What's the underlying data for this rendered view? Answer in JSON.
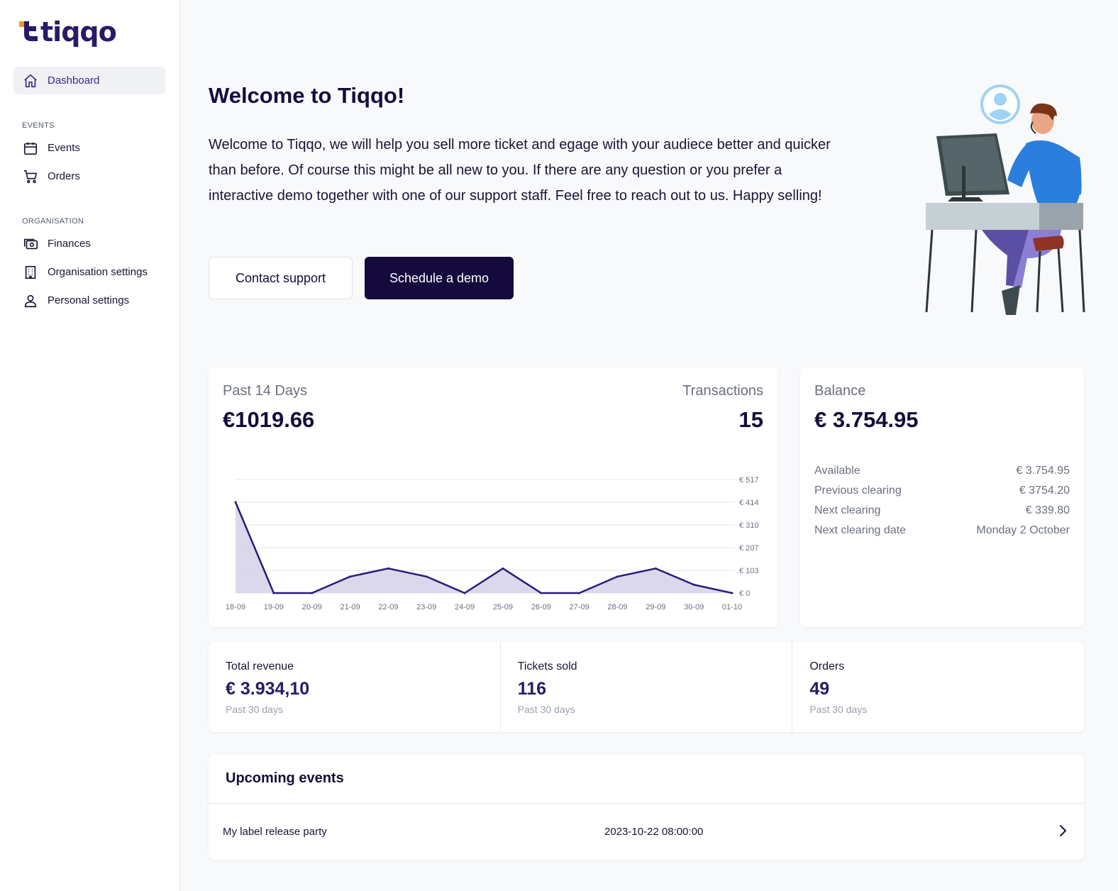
{
  "brand": {
    "name": "tiqqo",
    "accent": "#2a1a66",
    "orange": "#f7931e"
  },
  "sidebar": {
    "dashboard": "Dashboard",
    "events_section": "EVENTS",
    "events": "Events",
    "orders": "Orders",
    "organisation_section": "ORGANISATION",
    "finances": "Finances",
    "organisation_settings": "Organisation settings",
    "personal_settings": "Personal settings"
  },
  "welcome": {
    "title": "Welcome to Tiqqo!",
    "text": "Welcome to Tiqqo, we will help you sell more ticket and egage with your audiece better and quicker than before. Of course this might be all new to you. If there are any question or you prefer a interactive demo together with one of our support staff. Feel free to reach out to us. Happy selling!",
    "contact_support": "Contact support",
    "schedule_demo": "Schedule a demo"
  },
  "summary": {
    "period_label": "Past 14 Days",
    "period_value": "€1019.66",
    "transactions_label": "Transactions",
    "transactions_value": "15"
  },
  "chart_data": {
    "type": "area",
    "categories": [
      "18-09",
      "19-09",
      "20-09",
      "21-09",
      "22-09",
      "23-09",
      "24-09",
      "25-09",
      "26-09",
      "27-09",
      "28-09",
      "29-09",
      "30-09",
      "01-10"
    ],
    "values": [
      414,
      0,
      0,
      75,
      112,
      75,
      0,
      112,
      0,
      0,
      75,
      112,
      38,
      0
    ],
    "ylim": [
      0,
      517
    ],
    "yticks": [
      "€ 0",
      "€ 103",
      "€ 207",
      "€ 310",
      "€ 414",
      "€ 517"
    ],
    "ytick_values": [
      0,
      103,
      207,
      310,
      414,
      517
    ],
    "line_color": "#2a1a7a",
    "fill_color": "#d8d4ea",
    "grid": true,
    "title": "",
    "xlabel": "",
    "ylabel": ""
  },
  "balance": {
    "title": "Balance",
    "value": "€ 3.754.95",
    "rows": [
      {
        "label": "Available",
        "value": "€ 3.754.95"
      },
      {
        "label": "Previous clearing",
        "value": "€ 3754.20"
      },
      {
        "label": "Next clearing",
        "value": "€ 339.80"
      },
      {
        "label": "Next clearing date",
        "value": "Monday 2 October"
      }
    ]
  },
  "stats": [
    {
      "label": "Total revenue",
      "value": "€ 3.934,10",
      "sub": "Past 30 days"
    },
    {
      "label": "Tickets sold",
      "value": "116",
      "sub": "Past 30 days"
    },
    {
      "label": "Orders",
      "value": "49",
      "sub": "Past 30 days"
    }
  ],
  "upcoming": {
    "title": "Upcoming events",
    "events": [
      {
        "name": "My label release party",
        "date": "2023-10-22 08:00:00"
      }
    ]
  }
}
